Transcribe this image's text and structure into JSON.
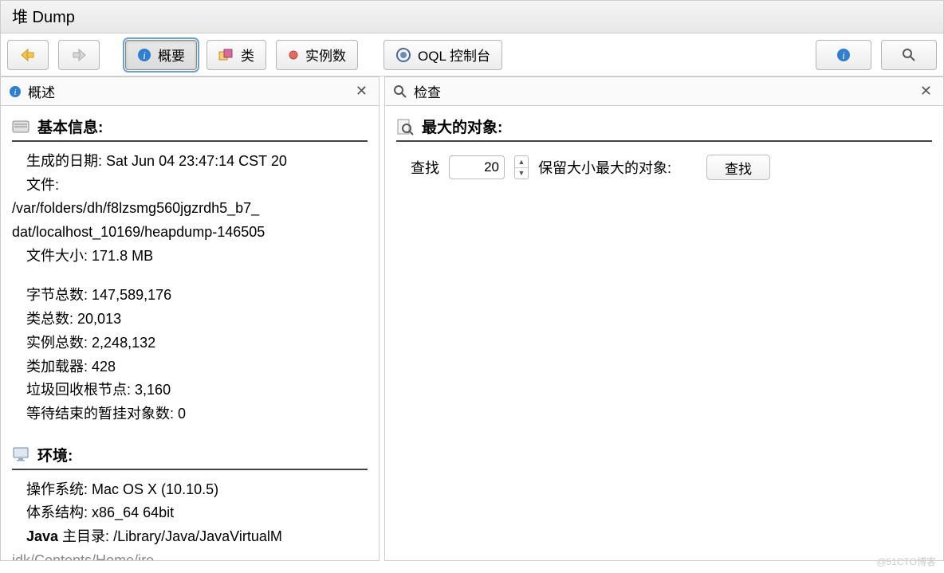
{
  "title": "堆 Dump",
  "toolbar": {
    "overview": "概要",
    "classes": "类",
    "instances": "实例数",
    "oql": "OQL 控制台"
  },
  "left_panel": {
    "title": "概述",
    "basic_info": {
      "heading": "基本信息:",
      "fields": {
        "gen_date_label": "生成的日期:",
        "gen_date_value": "Sat Jun 04 23:47:14 CST 20",
        "file_label": "文件:",
        "file_path1": "/var/folders/dh/f8lzsmg560jgzrdh5_b7_",
        "file_path2": "dat/localhost_10169/heapdump-146505",
        "file_size_label": "文件大小:",
        "file_size_value": "171.8 MB",
        "bytes_label": "字节总数:",
        "bytes_value": "147,589,176",
        "classes_label": "类总数:",
        "classes_value": "20,013",
        "instances_label": "实例总数:",
        "instances_value": "2,248,132",
        "classloaders_label": "类加载器:",
        "classloaders_value": "428",
        "gcroots_label": "垃圾回收根节点:",
        "gcroots_value": "3,160",
        "pending_label": "等待结束的暂挂对象数:",
        "pending_value": "0"
      }
    },
    "env": {
      "heading": "环境:",
      "fields": {
        "os_label": "操作系统:",
        "os_value": "Mac OS X (10.10.5)",
        "arch_label": "体系结构:",
        "arch_value": "x86_64 64bit",
        "javahome_label_prefix": "Java",
        "javahome_label": " 主目录:",
        "javahome_value": "/Library/Java/JavaVirtualM",
        "jdk_truncated": "idk/Contents/Home/ire"
      }
    }
  },
  "right_panel": {
    "title": "检查",
    "heading": "最大的对象:",
    "find_label": "查找",
    "count_value": "20",
    "retain_label": "保留大小最大的对象:",
    "find_button": "查找"
  },
  "watermark": "@51CTO博客"
}
